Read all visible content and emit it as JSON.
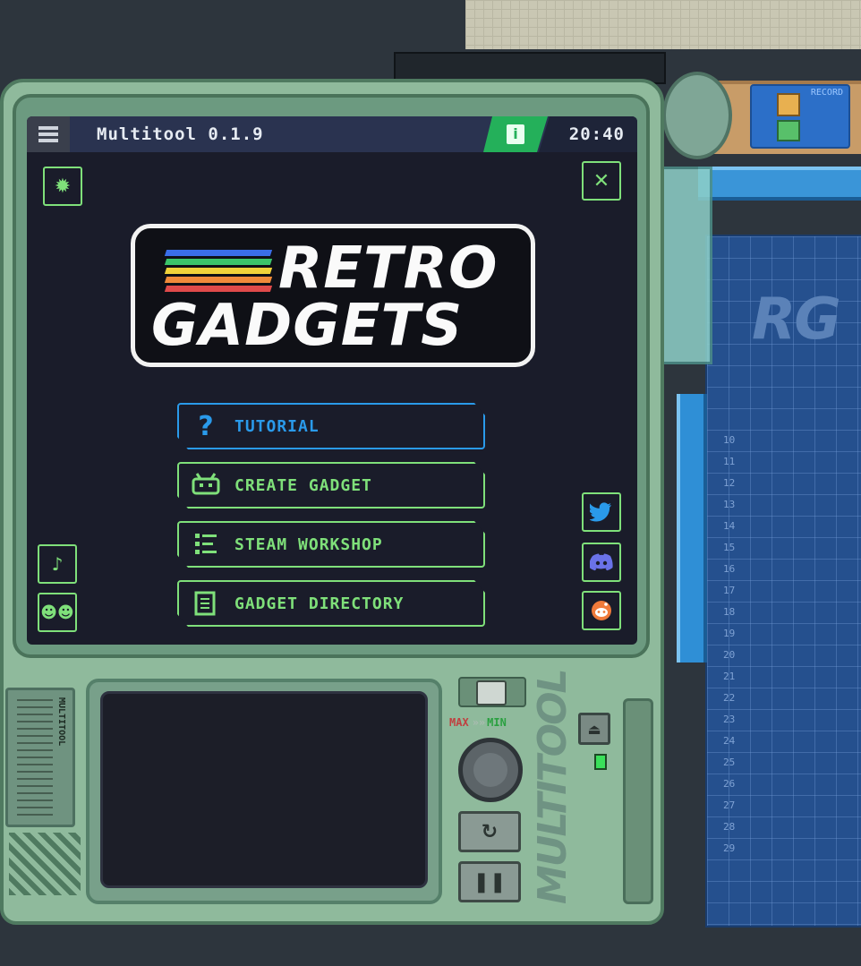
{
  "header": {
    "title": "Multitool 0.1.9",
    "clock": "20:40",
    "info_icon": "info-icon",
    "menu_icon": "hamburger-menu-icon"
  },
  "logo": {
    "line1": "RETRO",
    "line2": "GADGETS",
    "stripe_colors": [
      "#3a6ee8",
      "#3bc46a",
      "#f0d23a",
      "#f08a3a",
      "#e04a4a"
    ]
  },
  "menu": {
    "items": [
      {
        "label": "TUTORIAL",
        "icon": "question-mark-icon",
        "active": true
      },
      {
        "label": "CREATE GADGET",
        "icon": "gadget-icon",
        "active": false
      },
      {
        "label": "STEAM WORKSHOP",
        "icon": "list-icon",
        "active": false
      },
      {
        "label": "GADGET DIRECTORY",
        "icon": "document-icon",
        "active": false
      }
    ]
  },
  "device": {
    "dial_max_label": "MAX",
    "dial_min_label": "MIN",
    "brand": "MULTITOOL",
    "panel_label": "MULTITOOL",
    "record_label": "RECORD"
  },
  "mat": {
    "logo": "RG",
    "ruler": [
      "10",
      "11",
      "12",
      "13",
      "14",
      "15",
      "16",
      "17",
      "18",
      "19",
      "20",
      "21",
      "22",
      "23",
      "24",
      "25",
      "26",
      "27",
      "28",
      "29"
    ]
  },
  "colors": {
    "accent_green": "#7fe07a",
    "accent_blue": "#2a9aea",
    "screen_bg": "#1a1c2a",
    "info_green": "#24b05a"
  }
}
